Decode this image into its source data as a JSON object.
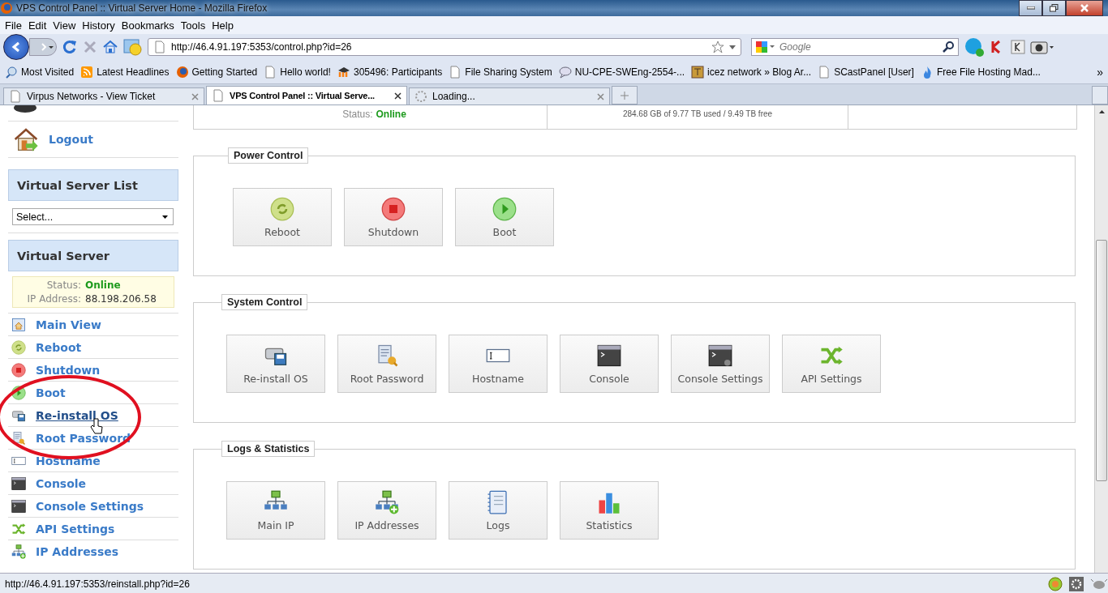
{
  "window": {
    "title": "VPS Control Panel :: Virtual Server Home - Mozilla Firefox"
  },
  "menu": [
    "File",
    "Edit",
    "View",
    "History",
    "Bookmarks",
    "Tools",
    "Help"
  ],
  "address_bar": {
    "value": "http://46.4.91.197:5353/control.php?id=26"
  },
  "search": {
    "placeholder": "Google"
  },
  "bookmarks": [
    {
      "label": "Most Visited",
      "kind": "search"
    },
    {
      "label": "Latest Headlines",
      "kind": "rss"
    },
    {
      "label": "Getting Started",
      "kind": "firefox"
    },
    {
      "label": "Hello world!",
      "kind": "page"
    },
    {
      "label": "305496: Participants",
      "kind": "moodle"
    },
    {
      "label": "File Sharing System",
      "kind": "page"
    },
    {
      "label": "NU-CPE-SWEng-2554-...",
      "kind": "chat"
    },
    {
      "label": "icez network » Blog Ar...",
      "kind": "image"
    },
    {
      "label": "SCastPanel [User]",
      "kind": "page"
    },
    {
      "label": "Free File Hosting Mad...",
      "kind": "flame"
    }
  ],
  "bookmarks_more": "»",
  "tabs": [
    {
      "label": "Virpus Networks - View Ticket",
      "selected": false,
      "kind": "page"
    },
    {
      "label": "VPS Control Panel :: Virtual Serve...",
      "selected": true,
      "kind": "page"
    },
    {
      "label": "Loading...",
      "selected": false,
      "kind": "loading"
    }
  ],
  "sidebar": {
    "links": [
      {
        "label": "Logout",
        "kind": "logout"
      }
    ],
    "server_list": {
      "title": "Virtual Server List",
      "select": "Select..."
    },
    "server": {
      "title": "Virtual Server",
      "status_label": "Status:",
      "status": "Online",
      "ip_label": "IP Address:",
      "ip": "88.198.206.58"
    },
    "nav": [
      {
        "label": "Main View",
        "kind": "home",
        "hovered": false
      },
      {
        "label": "Reboot",
        "kind": "reboot",
        "hovered": false
      },
      {
        "label": "Shutdown",
        "kind": "shutdown",
        "hovered": false
      },
      {
        "label": "Boot",
        "kind": "boot",
        "hovered": false
      },
      {
        "label": "Re-install OS",
        "kind": "reinstall",
        "hovered": true
      },
      {
        "label": "Root Password",
        "kind": "password",
        "hovered": false
      },
      {
        "label": "Hostname",
        "kind": "hostname",
        "hovered": false
      },
      {
        "label": "Console",
        "kind": "console",
        "hovered": false
      },
      {
        "label": "Console Settings",
        "kind": "console",
        "hovered": false
      },
      {
        "label": "API Settings",
        "kind": "api",
        "hovered": false
      },
      {
        "label": "IP Addresses",
        "kind": "ipadd",
        "hovered": false
      }
    ]
  },
  "summary": {
    "status_label": "Status:",
    "status": "Online",
    "storage": "284.68 GB of 9.77 TB used / 9.49 TB free"
  },
  "sections": [
    {
      "title": "Power Control",
      "buttons": [
        {
          "label": "Reboot",
          "kind": "reboot"
        },
        {
          "label": "Shutdown",
          "kind": "shutdown"
        },
        {
          "label": "Boot",
          "kind": "boot"
        }
      ]
    },
    {
      "title": "System Control",
      "buttons": [
        {
          "label": "Re-install OS",
          "kind": "reinstall"
        },
        {
          "label": "Root Password",
          "kind": "password"
        },
        {
          "label": "Hostname",
          "kind": "hostname"
        },
        {
          "label": "Console",
          "kind": "console"
        },
        {
          "label": "Console Settings",
          "kind": "consolesettings"
        },
        {
          "label": "API Settings",
          "kind": "api"
        }
      ]
    },
    {
      "title": "Logs & Statistics",
      "buttons": [
        {
          "label": "Main IP",
          "kind": "mainip"
        },
        {
          "label": "IP Addresses",
          "kind": "ipadd"
        },
        {
          "label": "Logs",
          "kind": "logs"
        },
        {
          "label": "Statistics",
          "kind": "stats"
        }
      ]
    }
  ],
  "status_bar": {
    "text": "http://46.4.91.197:5353/reinstall.php?id=26"
  }
}
